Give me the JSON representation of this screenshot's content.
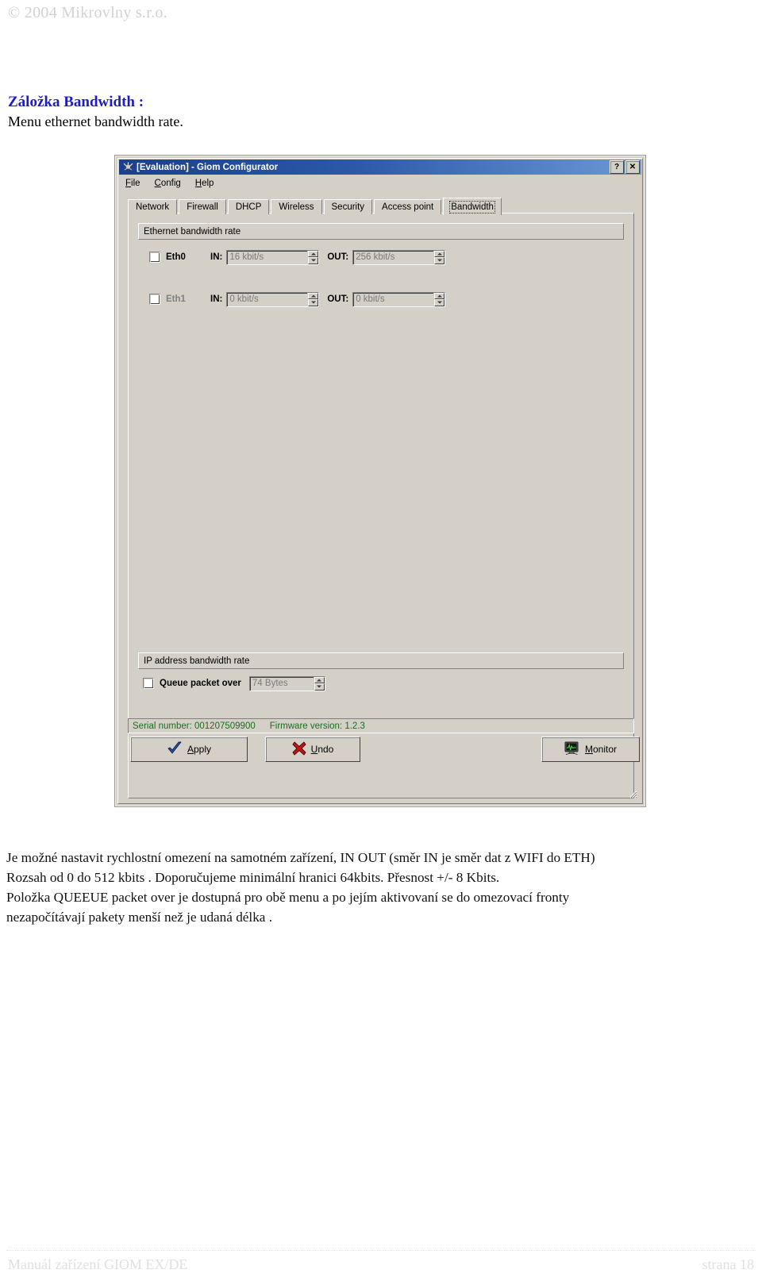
{
  "page": {
    "copyright": "© 2004 Mikrovlny s.r.o.",
    "section_title": "Záložka Bandwidth :",
    "section_subtitle": "Menu ethernet bandwidth rate.",
    "body_lines": [
      "Je možné nastavit rychlostní omezení na samotném zařízení, IN OUT (směr IN je směr dat z WIFI do ETH)",
      "Rozsah od 0 do 512 kbits . Doporučujeme minimální hranici 64kbits. Přesnost +/- 8 Kbits.",
      "Položka QUEEUE packet over je dostupná pro obě menu a po jejím aktivovaní se do omezovací fronty",
      "nezapočítávají pakety menší než je udaná délka ."
    ],
    "footer_left": "Manuál zařízení GIOM EX/DE",
    "footer_right": "strana 18"
  },
  "window": {
    "title": "[Evaluation] - Giom Configurator",
    "icon": "app-icon",
    "help_button": "?",
    "close_button": "✕",
    "menu": [
      {
        "label": "File",
        "mnemonic": "F"
      },
      {
        "label": "Config",
        "mnemonic": "C"
      },
      {
        "label": "Help",
        "mnemonic": "H"
      }
    ],
    "tabs": [
      {
        "label": "Network",
        "active": false
      },
      {
        "label": "Firewall",
        "active": false
      },
      {
        "label": "DHCP",
        "active": false
      },
      {
        "label": "Wireless",
        "active": false
      },
      {
        "label": "Security",
        "active": false
      },
      {
        "label": "Access point",
        "active": false
      },
      {
        "label": "Bandwidth",
        "active": true
      }
    ]
  },
  "ethernet_group": {
    "title": "Ethernet bandwidth rate",
    "rows": [
      {
        "checkbox_name": "eth0-enable-checkbox",
        "label": "Eth0",
        "enabled": true,
        "in_label": "IN:",
        "in_value": "16 kbit/s",
        "out_label": "OUT:",
        "out_value": "256 kbit/s"
      },
      {
        "checkbox_name": "eth1-enable-checkbox",
        "label": "Eth1",
        "enabled": false,
        "in_label": "IN:",
        "in_value": "0 kbit/s",
        "out_label": "OUT:",
        "out_value": "0 kbit/s"
      }
    ]
  },
  "ip_group": {
    "title": "IP address bandwidth rate",
    "queue_label": "Queue packet over",
    "queue_value": "74 Bytes"
  },
  "statusbar": {
    "serial_label": "Serial number:",
    "serial_value": "001207509900",
    "firmware_label": "Firmware version:",
    "firmware_value": "1.2.3",
    "text_color": "#1f6b1f"
  },
  "actions": [
    {
      "label": "Apply",
      "mnemonic": "A",
      "icon": "check-icon"
    },
    {
      "label": "Undo",
      "mnemonic": "U",
      "icon": "red-x-icon"
    },
    {
      "label": "Monitor",
      "mnemonic": "M",
      "icon": "monitor-icon"
    }
  ],
  "colors": {
    "accent_heading": "#1c1ccc",
    "window_face": "#d4d0c8",
    "titlebar_start": "#1b3f8b",
    "titlebar_end": "#6c98d4",
    "status_green": "#1f6b1f"
  }
}
